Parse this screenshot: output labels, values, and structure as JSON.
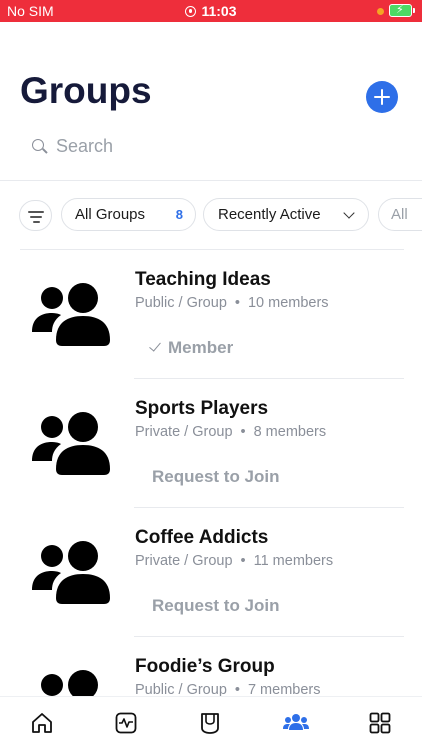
{
  "status_bar": {
    "carrier": "No SIM",
    "time": "11:03"
  },
  "colors": {
    "status_bar": "#ee2e3b",
    "accent": "#2e6fe8",
    "title": "#161a3a",
    "muted": "#9aa0a8"
  },
  "header": {
    "title": "Groups",
    "add_icon": "plus-icon"
  },
  "search": {
    "placeholder": "Search",
    "value": ""
  },
  "filters": {
    "all_groups_label": "All Groups",
    "all_groups_count": "8",
    "sort_label": "Recently Active",
    "partial_label": "All"
  },
  "groups": [
    {
      "name": "Teaching Ideas",
      "privacy": "Public / Group",
      "members": "10 members",
      "action": "Member",
      "is_member": true
    },
    {
      "name": "Sports Players",
      "privacy": "Private / Group",
      "members": "8 members",
      "action": "Request to Join",
      "is_member": false
    },
    {
      "name": "Coffee Addicts",
      "privacy": "Private / Group",
      "members": "11 members",
      "action": "Request to Join",
      "is_member": false
    },
    {
      "name": "Foodie’s Group",
      "privacy": "Public / Group",
      "members": "7 members",
      "action": "",
      "is_member": false
    }
  ],
  "tab_bar": {
    "tabs": [
      {
        "icon": "home-icon",
        "active": false
      },
      {
        "icon": "activity-icon",
        "active": false
      },
      {
        "icon": "profile-card-icon",
        "active": false
      },
      {
        "icon": "groups-icon",
        "active": true
      },
      {
        "icon": "grid-icon",
        "active": false
      }
    ]
  }
}
